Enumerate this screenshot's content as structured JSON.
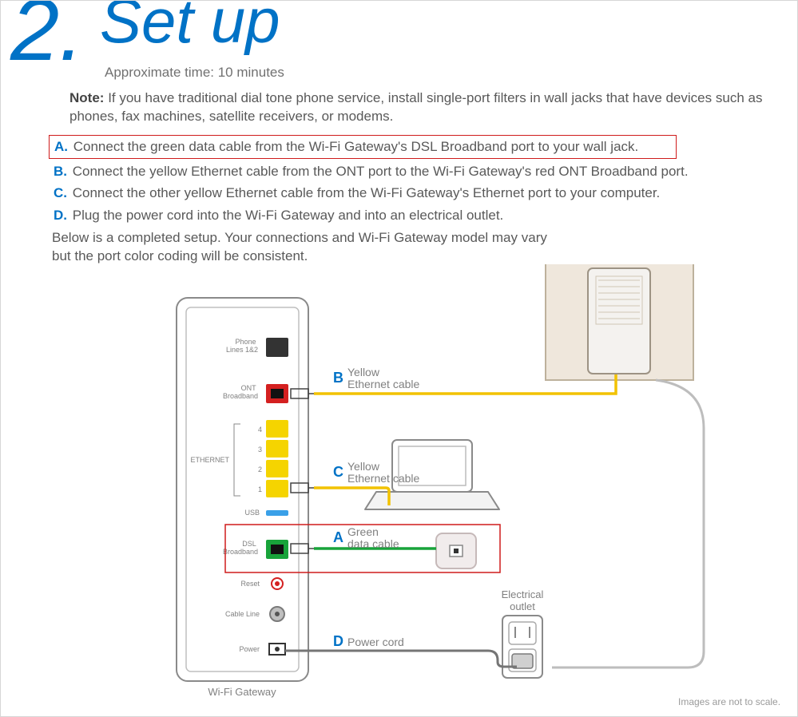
{
  "heading": {
    "step_number": "2.",
    "title": "Set up",
    "approx_time": "Approximate time: 10 minutes"
  },
  "note": {
    "label": "Note:",
    "text": "If you have traditional dial tone phone service, install single-port filters in wall jacks that have devices such as phones, fax machines, satellite receivers, or modems."
  },
  "steps": {
    "a": {
      "letter": "A.",
      "text": "Connect the green data cable from the Wi-Fi Gateway's DSL Broadband port to your wall jack."
    },
    "b": {
      "letter": "B.",
      "text": "Connect the yellow Ethernet cable from the ONT port to the Wi-Fi Gateway's red ONT Broadband port."
    },
    "c": {
      "letter": "C.",
      "text": "Connect the other yellow Ethernet cable from the Wi-Fi Gateway's Ethernet port to your computer."
    },
    "d": {
      "letter": "D.",
      "text": "Plug the power cord into the Wi-Fi Gateway and into an electrical outlet."
    }
  },
  "below_text": "Below is a completed setup. Your connections and Wi-Fi Gateway model may vary but the port color coding will be consistent.",
  "gateway": {
    "caption": "Wi-Fi Gateway",
    "ports": {
      "phone": "Phone\nLines 1&2",
      "ont": "ONT\nBroadband",
      "ethernet_group": "ETHERNET",
      "eth_nums": [
        "4",
        "3",
        "2",
        "1"
      ],
      "usb": "USB",
      "dsl": "DSL\nBroadband",
      "reset": "Reset",
      "cable": "Cable Line",
      "power": "Power"
    }
  },
  "cables": {
    "b": {
      "letter": "B",
      "line1": "Yellow",
      "line2": "Ethernet cable"
    },
    "c": {
      "letter": "C",
      "line1": "Yellow",
      "line2": "Ethernet cable"
    },
    "a": {
      "letter": "A",
      "line1": "Green",
      "line2": "data cable"
    },
    "d": {
      "letter": "D",
      "line1": "Power cord"
    }
  },
  "outlet_label": {
    "line1": "Electrical",
    "line2": "outlet"
  },
  "footer": "Images are not to scale."
}
